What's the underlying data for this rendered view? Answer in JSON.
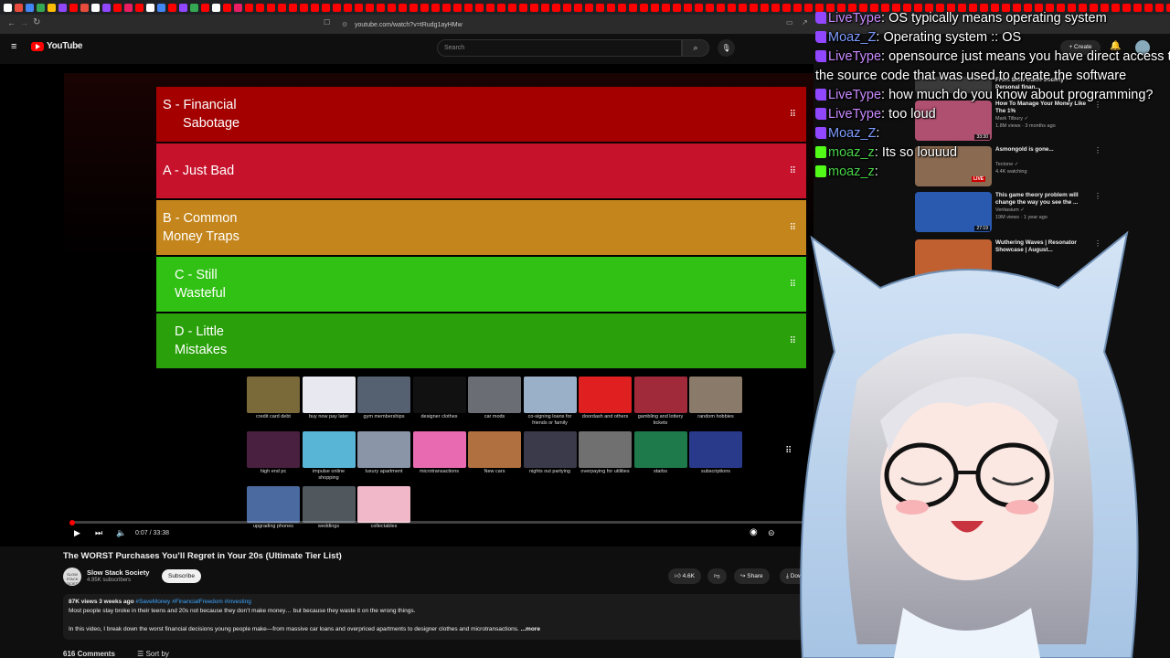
{
  "browser": {
    "url": "youtube.com/watch?v=tRudg1ayHMw",
    "tab_colors": [
      "#ffffff",
      "#e74c3c",
      "#4285f4",
      "#34a853",
      "#fbbc05",
      "#9146ff",
      "#ff0000",
      "#e74c3c",
      "#ffffff",
      "#9146ff",
      "#ff0000",
      "#e91e63",
      "#ff0000",
      "#ffffff",
      "#4285f4",
      "#ff0000",
      "#9146ff",
      "#34a853",
      "#ff0000",
      "#ffffff",
      "#ff0000",
      "#e91e63",
      "#ff0000",
      "#ff0000",
      "#ff0000",
      "#ff0000",
      "#ff0000",
      "#ff0000",
      "#ff0000",
      "#ff0000",
      "#ff0000",
      "#ff0000",
      "#ff0000",
      "#ff0000",
      "#ff0000",
      "#ff0000",
      "#ff0000",
      "#ff0000",
      "#ff0000",
      "#ff0000",
      "#ff0000",
      "#ff0000",
      "#ff0000",
      "#ff0000",
      "#ff0000",
      "#ff0000",
      "#ff0000",
      "#ff0000",
      "#ff0000",
      "#ff0000",
      "#ff0000",
      "#ff0000",
      "#ff0000",
      "#ff0000",
      "#ff0000",
      "#ff0000",
      "#ff0000",
      "#ff0000",
      "#ff0000",
      "#ff0000",
      "#ff0000",
      "#ff0000",
      "#ff0000",
      "#ff0000",
      "#ff0000",
      "#ff0000",
      "#ff0000",
      "#ff0000",
      "#ff0000",
      "#ff0000",
      "#ff0000",
      "#ff0000",
      "#ff0000",
      "#ff0000",
      "#ff0000",
      "#ff0000",
      "#ff0000",
      "#ff0000",
      "#ff0000",
      "#ff0000",
      "#ff0000",
      "#ff0000",
      "#ff0000",
      "#ff0000",
      "#ff0000",
      "#ff0000",
      "#ff0000",
      "#ff0000",
      "#ff0000",
      "#ff0000",
      "#ff0000",
      "#ff0000",
      "#ff0000",
      "#ff0000",
      "#ff0000",
      "#ff0000",
      "#ff0000",
      "#ff0000",
      "#ff0000",
      "#ff0000",
      "#ff0000",
      "#ff0000",
      "#ff0000",
      "#ff0000",
      "#ff0000",
      "#ff0000",
      "#ff0000",
      "#ff0000",
      "#ff0000",
      "#ff0000",
      "#ff0000",
      "#ff0000",
      "#ff0000",
      "#ff0000",
      "#ff0000",
      "#ff0000",
      "#ff0000",
      "#ff0000",
      "#ff0000",
      "#ff0000",
      "#ff0000",
      "#ff0000",
      "#ff0000",
      "#ff0000",
      "#ff0000"
    ]
  },
  "youtube": {
    "logo": "YouTube",
    "search_placeholder": "Search",
    "create_label": "+ Create"
  },
  "tierlist": {
    "tiers": [
      {
        "label": "S - Financial Sabotage",
        "line1": "S - Financial",
        "line2": "Sabotage",
        "color": "#a40000"
      },
      {
        "label": "A - Just Bad",
        "line1": "A - Just Bad",
        "line2": "",
        "color": "#c6122b"
      },
      {
        "label": "B - Common Money Traps",
        "line1": "B - Common",
        "line2": "Money Traps",
        "color": "#c4861c"
      },
      {
        "label": "C - Still Wasteful",
        "line1": "C - Still",
        "line2": "Wasteful",
        "color": "#31c014"
      },
      {
        "label": "D - Little Mistakes",
        "line1": "D - Little",
        "line2": "Mistakes",
        "color": "#2aa10a"
      }
    ],
    "items": [
      {
        "caption": "credit card debt",
        "color": "#7a6a3a"
      },
      {
        "caption": "buy now pay later",
        "color": "#e8e8f0"
      },
      {
        "caption": "gym memberships",
        "color": "#556070"
      },
      {
        "caption": "designer clothes",
        "color": "#111111"
      },
      {
        "caption": "car mods",
        "color": "#6a6e74"
      },
      {
        "caption": "co-signing loans for friends or family",
        "color": "#9ab0c8"
      },
      {
        "caption": "doordash and others",
        "color": "#e02020"
      },
      {
        "caption": "gambling and lottery tickets",
        "color": "#a02a3a"
      },
      {
        "caption": "random hobbies",
        "color": "#8a7a6a"
      },
      {
        "caption": "high end pc",
        "color": "#4a2040"
      },
      {
        "caption": "impulse online shopping",
        "color": "#59b5d6"
      },
      {
        "caption": "luxury apartment",
        "color": "#8a96a8"
      },
      {
        "caption": "microtransactions",
        "color": "#e86ab0"
      },
      {
        "caption": "New cars",
        "color": "#b07040"
      },
      {
        "caption": "nights out partying",
        "color": "#3a3a4a"
      },
      {
        "caption": "overpaying for utilities",
        "color": "#707070"
      },
      {
        "caption": "starbs",
        "color": "#1e7a4a"
      },
      {
        "caption": "subscriptions",
        "color": "#2a3a8a"
      },
      {
        "caption": "upgrading phones",
        "color": "#4a6aa0"
      },
      {
        "caption": "weddings",
        "color": "#50585e"
      },
      {
        "caption": "collectables",
        "color": "#f0b8c8"
      }
    ]
  },
  "player": {
    "time": "0:07 / 33:38",
    "progress": 0.0035
  },
  "video": {
    "title": "The WORST Purchases You’ll Regret in Your 20s (Ultimate Tier List)",
    "channel": "Slow Stack Society",
    "avatar_text": "SLOW STACK SOCIETY",
    "subscribers": "4.95K subscribers",
    "subscribe_label": "Subscribe",
    "likes": "4.6K",
    "share_label": "Share",
    "download_label": "Down",
    "stats": "87K views  3 weeks ago",
    "hashtags": "#SaveMoney #FinancialFreedom #investing",
    "desc_line1": "Most people stay broke in their teens and 20s not because they don’t make money… but because they waste it on the wrong things.",
    "desc_line2": "In this video, I break down the worst financial decisions young people make—from massive car loans and overpriced apartments to designer clothes and microtransactions.",
    "more": "...more",
    "comments_label": "616 Comments",
    "sort_label": "Sort by"
  },
  "sidebar": {
    "recs": [
      {
        "title": "From Slow Stack Society · Personal finan...",
        "meta1": "",
        "meta2": "",
        "duration": "",
        "color": "#3a3a3a"
      },
      {
        "title": "How To Manage Your Money Like The 1%",
        "meta1": "Mark Tilbury ✓",
        "meta2": "1.8M views · 3 months ago",
        "duration": "33:30",
        "color": "#b05070"
      },
      {
        "title": "Asmongold is gone...",
        "meta1": "Tectone ✓",
        "meta2": "4.4K watching",
        "duration": "",
        "live": "LIVE",
        "color": "#8a6a50"
      },
      {
        "title": "This game theory problem will change the way you see the ...",
        "meta1": "Veritasium ✓",
        "meta2": "19M views · 1 year ago",
        "duration": "27:19",
        "color": "#2a5ab0"
      },
      {
        "title": "Wuthering Waves | Resonator Showcase | August...",
        "meta1": "",
        "meta2": "",
        "duration": "",
        "color": "#c06030"
      }
    ]
  },
  "chat": [
    {
      "user": "LiveType",
      "badge": "twitch",
      "text": ": OS typically means operating system"
    },
    {
      "user": "Moaz_Z",
      "badge": "twitch",
      "text": ": Operating system :: OS"
    },
    {
      "user": "LiveType",
      "badge": "twitch",
      "text": ": opensource just means you have direct access to"
    },
    {
      "user": "",
      "badge": "",
      "text": "the source code that was used to create the software"
    },
    {
      "user": "LiveType",
      "badge": "twitch",
      "text": ": how much do you know about programming?"
    },
    {
      "user": "LiveType",
      "badge": "twitch",
      "text": ": too loud"
    },
    {
      "user": "Moaz_Z",
      "badge": "twitch",
      "text": ":"
    },
    {
      "user": "moaz_z",
      "badge": "kick",
      "text": ": Its so louuud"
    },
    {
      "user": "moaz_z",
      "badge": "kick",
      "text": ":"
    }
  ],
  "colors": {
    "twitch_purple": "#9146ff",
    "kick_green": "#53fc18",
    "yt_red": "#ff0000"
  }
}
